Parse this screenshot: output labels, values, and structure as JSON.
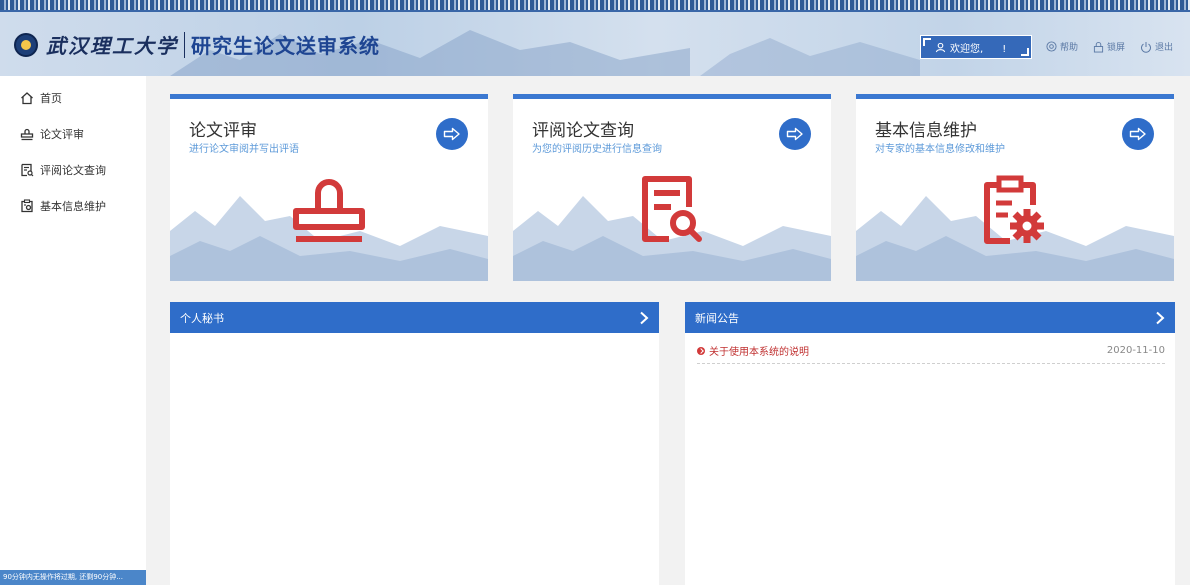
{
  "header": {
    "school_name": "武汉理工大学",
    "system_name": "研究生论文送审系统",
    "welcome_text": "欢迎您,      !",
    "help_label": "帮助",
    "lock_label": "锁屏",
    "logout_label": "退出"
  },
  "sidebar": {
    "items": [
      {
        "label": "首页",
        "icon": "home-icon"
      },
      {
        "label": "论文评审",
        "icon": "stamp-icon"
      },
      {
        "label": "评阅论文查询",
        "icon": "document-search-icon"
      },
      {
        "label": "基本信息维护",
        "icon": "clipboard-gear-icon"
      }
    ],
    "footer_text": "90分钟内无操作将过期, 还剩90分钟..."
  },
  "cards": [
    {
      "title": "论文评审",
      "subtitle": "进行论文审阅并写出评语",
      "icon": "stamp-icon"
    },
    {
      "title": "评阅论文查询",
      "subtitle": "为您的评阅历史进行信息查询",
      "icon": "document-search-icon"
    },
    {
      "title": "基本信息维护",
      "subtitle": "对专家的基本信息修改和维护",
      "icon": "clipboard-gear-icon"
    }
  ],
  "panels": {
    "secretary": {
      "title": "个人秘书"
    },
    "news": {
      "title": "新闻公告",
      "items": [
        {
          "title": "关于使用本系统的说明",
          "date": "2020-11-10"
        }
      ]
    }
  },
  "colors": {
    "primary": "#2f6dc9",
    "accent_red": "#d23a3a",
    "subtitle": "#5d9ad9"
  }
}
